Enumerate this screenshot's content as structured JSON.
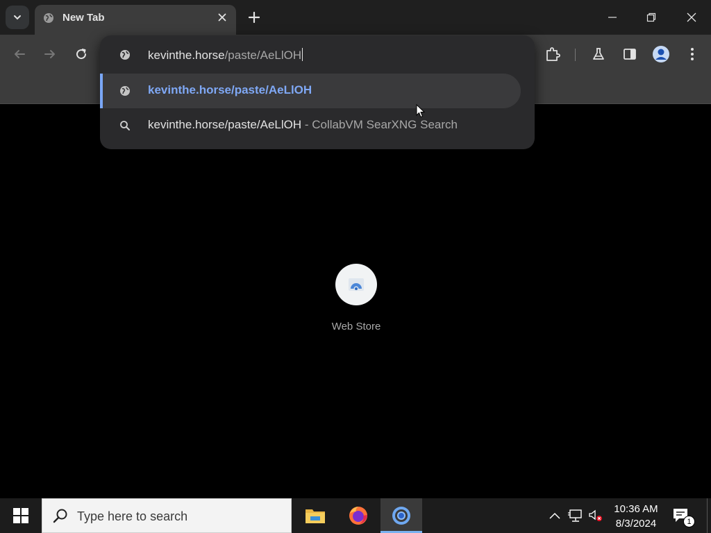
{
  "browser": {
    "tab": {
      "title": "New Tab"
    },
    "omnibox": {
      "typed_host": "kevinthe.horse",
      "typed_path": "/paste/AeLlOH",
      "suggestions": [
        {
          "text": "kevinthe.horse/paste/AeLlOH",
          "icon": "globe-icon",
          "selected": true
        },
        {
          "text": "kevinthe.horse/paste/AeLlOH",
          "separator": " - ",
          "engine": "CollabVM SearXNG Search",
          "icon": "search-icon",
          "selected": false
        }
      ]
    },
    "accent_color": "#7aa7f7"
  },
  "newtab": {
    "shortcuts": [
      {
        "label": "Web Store"
      }
    ]
  },
  "taskbar": {
    "search_placeholder": "Type here to search",
    "clock": {
      "time": "10:36 AM",
      "date": "8/3/2024"
    },
    "notification_count": "1"
  }
}
